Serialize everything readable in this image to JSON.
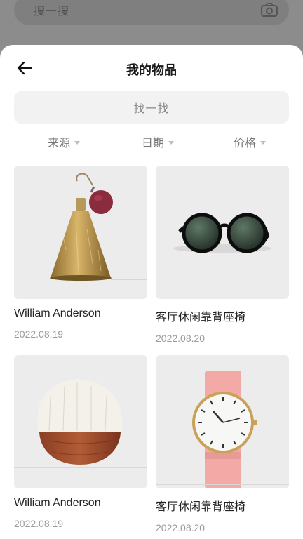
{
  "background": {
    "search_placeholder": "搜一搜",
    "camera_icon": "camera-icon"
  },
  "sheet": {
    "title": "我的物品",
    "back_icon": "arrow-left-icon",
    "search_placeholder": "找一找",
    "filters": [
      {
        "label": "来源"
      },
      {
        "label": "日期"
      },
      {
        "label": "价格"
      }
    ],
    "items": [
      {
        "title": "William Anderson",
        "date": "2022.08.19",
        "image": "perfume-bottle"
      },
      {
        "title": "客厅休闲靠背座椅",
        "date": "2022.08.20",
        "image": "sunglasses"
      },
      {
        "title": "William Anderson",
        "date": "2022.08.19",
        "image": "brush"
      },
      {
        "title": "客厅休闲靠背座椅",
        "date": "2022.08.20",
        "image": "watch"
      }
    ]
  },
  "colors": {
    "sheet_bg": "#ffffff",
    "card_bg": "#ececec",
    "muted_text": "#9a9a9a"
  }
}
